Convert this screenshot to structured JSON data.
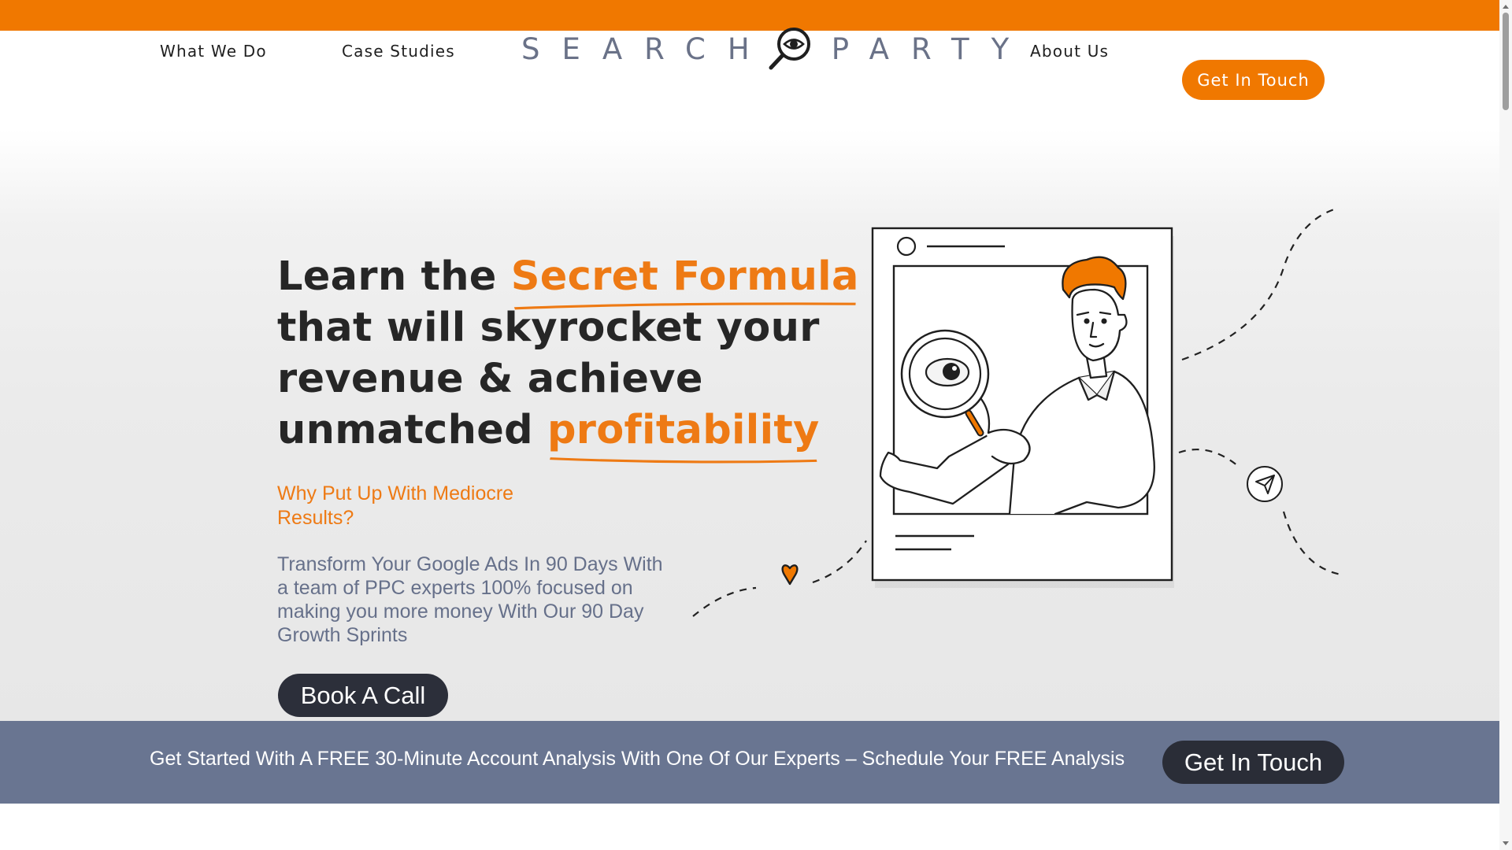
{
  "colors": {
    "brand_orange": "#f07800",
    "accent_text": "#ee7a14",
    "dark_button": "#2c2f3a",
    "cta_band": "#697591",
    "body_text": "#66708a"
  },
  "nav": {
    "items": [
      {
        "label": "What We Do"
      },
      {
        "label": "Case Studies"
      },
      {
        "label": "About Us"
      }
    ],
    "logo": {
      "left_word": "SEARCH",
      "right_word": "PARTY",
      "icon": "magnifier-eye-icon"
    },
    "cta_label": "Get In Touch"
  },
  "hero": {
    "headline": {
      "line1_pre": "Learn the ",
      "line1_accent": "Secret Formula",
      "line2": "that will skyrocket your",
      "line3": "revenue & achieve",
      "line4_pre": "unmatched ",
      "line4_accent": "profitability"
    },
    "subheading": "Why Put Up With Mediocre Results?",
    "body": "Transform Your Google Ads In 90 Days With a team of PPC experts 100% focused on making you more money With Our 90 Day Growth Sprints",
    "button_label": "Book A Call",
    "illustration_icons": [
      "heart-icon",
      "paper-plane-icon",
      "magnifying-glass-icon"
    ]
  },
  "cta_band": {
    "text": "Get Started With A FREE 30-Minute Account Analysis With One Of Our Experts – Schedule Your FREE Analysis",
    "button_label": "Get In Touch"
  }
}
